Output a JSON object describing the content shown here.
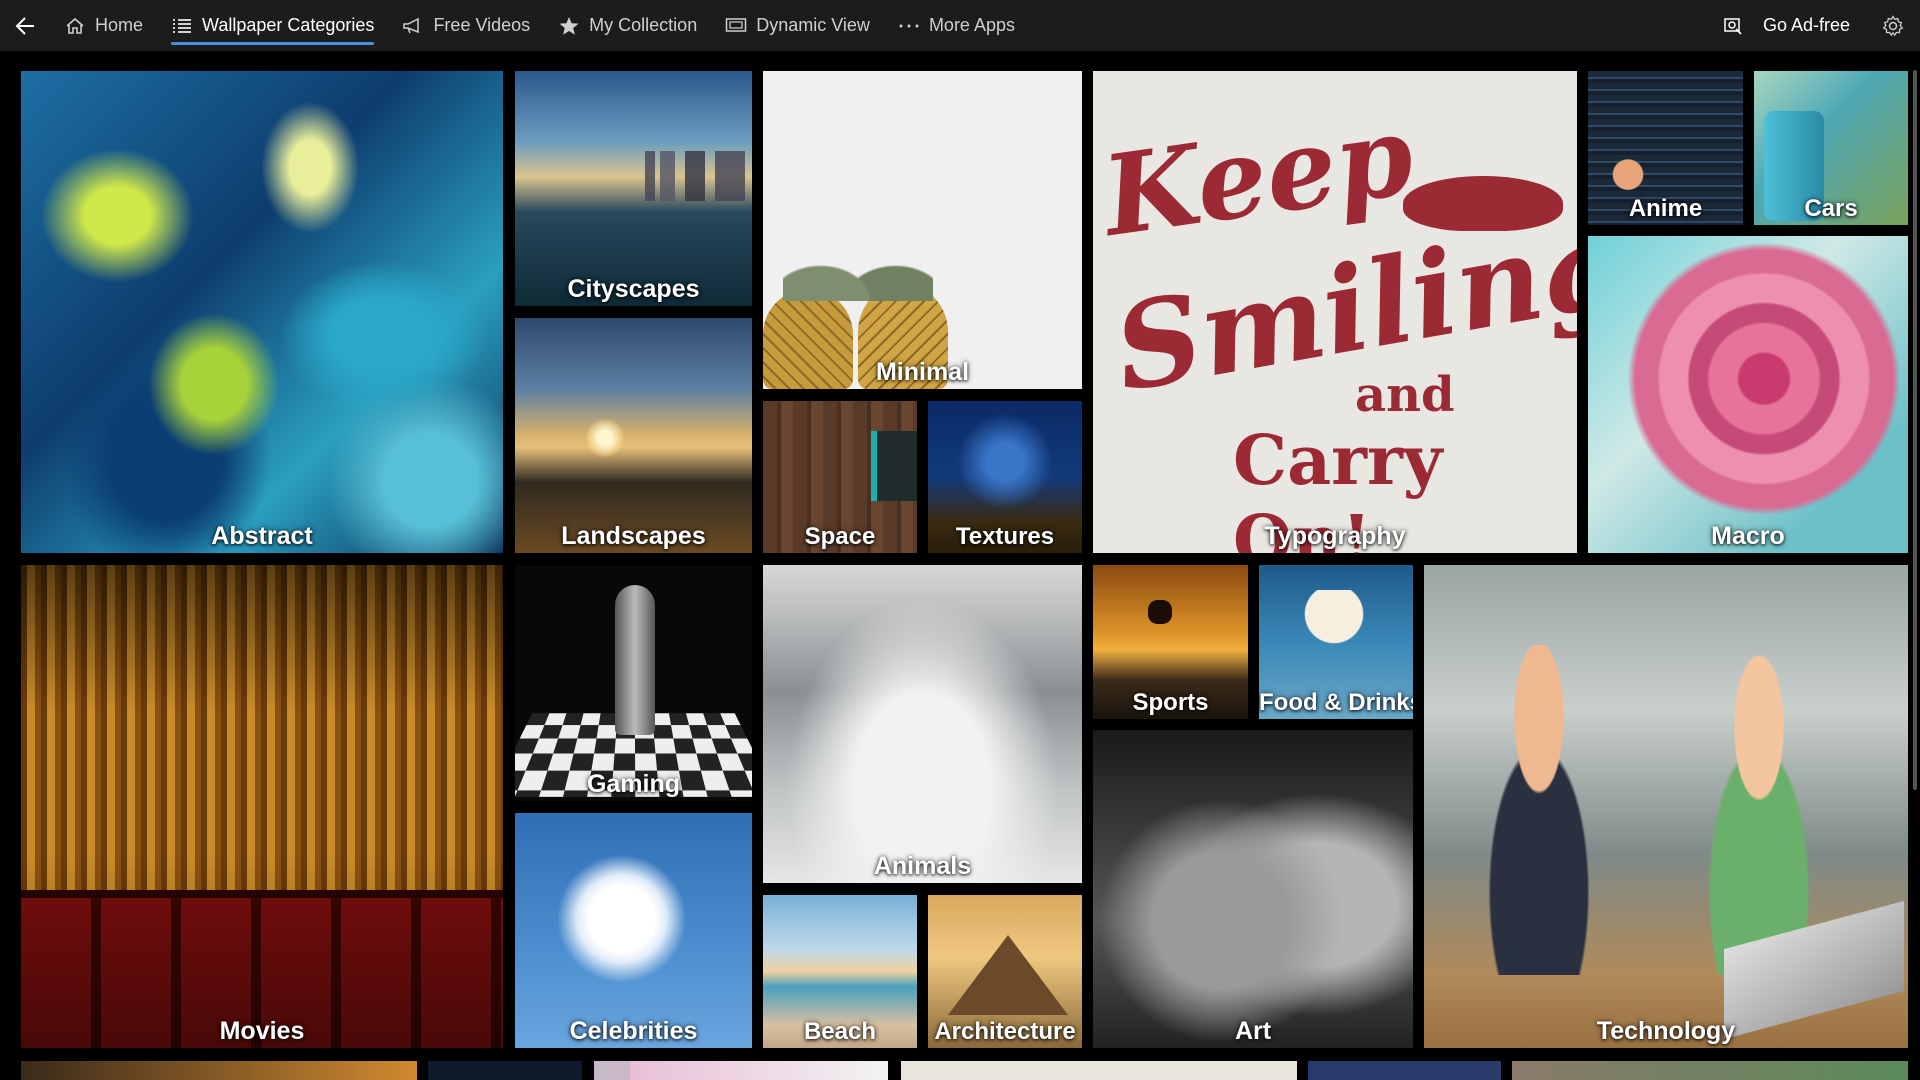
{
  "nav": {
    "back_icon": "back-arrow-icon",
    "items": [
      {
        "label": "Home",
        "icon": "home-icon"
      },
      {
        "label": "Wallpaper Categories",
        "icon": "list-icon",
        "active": true
      },
      {
        "label": "Free Videos",
        "icon": "megaphone-icon"
      },
      {
        "label": "My Collection",
        "icon": "star-icon"
      },
      {
        "label": "Dynamic View",
        "icon": "monitor-icon"
      },
      {
        "label": "More Apps",
        "icon": "more-icon"
      }
    ],
    "ad_free_label": "Go Ad-free",
    "ad_free_icon": "no-ads-icon",
    "settings_icon": "gear-icon",
    "accent": "#4a90e2"
  },
  "categories": [
    "Abstract",
    "Cityscapes",
    "Minimal",
    "Typography",
    "Anime",
    "Cars",
    "Landscapes",
    "Space",
    "Textures",
    "Macro",
    "Movies",
    "Gaming",
    "Animals",
    "Sports",
    "Food & Drinks",
    "Technology",
    "Celebrities",
    "Beach",
    "Architecture",
    "Art"
  ],
  "typography_tile": {
    "line1": "Keep",
    "line2": "Smiling",
    "line3": "and",
    "line4": "Carry On!"
  }
}
